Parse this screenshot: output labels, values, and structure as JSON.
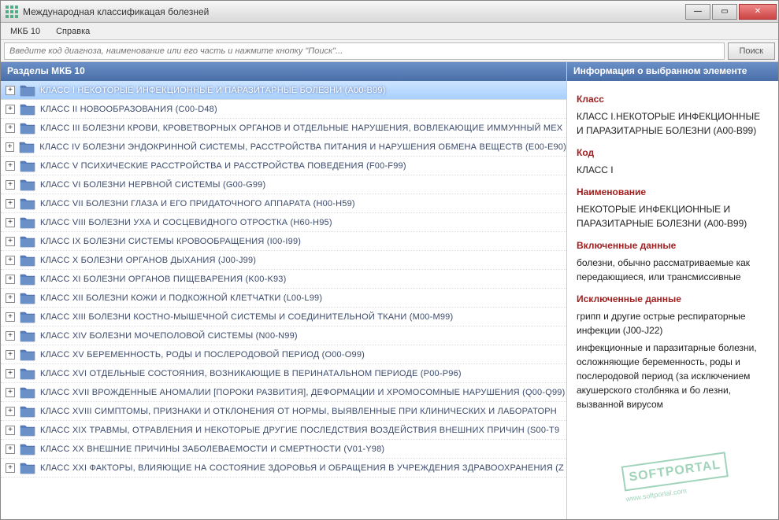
{
  "window": {
    "title": "Международная классификацая болезней"
  },
  "menu": {
    "mkb": "МКБ 10",
    "help": "Справка"
  },
  "search": {
    "placeholder": "Введите код диагноза, наименование или его часть и нажмите кнопку \"Поиск\"...",
    "button": "Поиск"
  },
  "left_header": "Разделы МКБ 10",
  "right_header": "Информация о выбранном элементе",
  "tree": [
    "КЛАСС I НЕКОТОРЫЕ ИНФЕКЦИОННЫЕ И ПАРАЗИТАРНЫЕ БОЛЕЗНИ (A00-B99)",
    "КЛАСС II НОВООБРАЗОВАНИЯ (C00-D48)",
    "КЛАСС III БОЛЕЗНИ КРОВИ, КРОВЕТВОРНЫХ ОРГАНОВ И ОТДЕЛЬНЫЕ НАРУШЕНИЯ, ВОВЛЕКАЮЩИЕ ИММУННЫЙ МЕХ",
    "КЛАСС IV БОЛЕЗНИ ЭНДОКРИННОЙ СИСТЕМЫ, РАССТРОЙСТВА ПИТАНИЯ И НАРУШЕНИЯ ОБМЕНА ВЕЩЕСТВ (E00-E90)",
    "КЛАСС V ПСИХИЧЕСКИЕ РАССТРОЙСТВА И РАССТРОЙСТВА ПОВЕДЕНИЯ (F00-F99)",
    "КЛАСС VI БОЛЕЗНИ НЕРВНОЙ СИСТЕМЫ (G00-G99)",
    "КЛАСС VII БОЛЕЗНИ ГЛАЗА И ЕГО ПРИДАТОЧНОГО АППАРАТА (H00-H59)",
    "КЛАСС VIII БОЛЕЗНИ УХА И СОСЦЕВИДНОГО ОТРОСТКА (H60-H95)",
    "КЛАСС IX БОЛЕЗНИ СИСТЕМЫ КРОВООБРАЩЕНИЯ (I00-I99)",
    "КЛАСС X БОЛЕЗНИ ОРГАНОВ ДЫХАНИЯ (J00-J99)",
    "КЛАСС XI БОЛЕЗНИ ОРГАНОВ ПИЩЕВАРЕНИЯ (K00-K93)",
    "КЛАСС XII БОЛЕЗНИ КОЖИ И ПОДКОЖНОЙ КЛЕТЧАТКИ (L00-L99)",
    "КЛАСС XIII БОЛЕЗНИ КОСТНО-МЫШЕЧНОЙ СИСТЕМЫ И СОЕДИНИТЕЛЬНОЙ ТКАНИ (M00-M99)",
    "КЛАСС XIV БОЛЕЗНИ МОЧЕПОЛОВОЙ СИСТЕМЫ (N00-N99)",
    "КЛАСС XV БЕРЕМЕННОСТЬ, РОДЫ И ПОСЛЕРОДОВОЙ ПЕРИОД (O00-O99)",
    "КЛАСС XVI ОТДЕЛЬНЫЕ СОСТОЯНИЯ, ВОЗНИКАЮЩИЕ В ПЕРИНАТАЛЬНОМ ПЕРИОДЕ (P00-P96)",
    "КЛАСС XVII ВРОЖДЕННЫЕ АНОМАЛИИ [ПОРОКИ РАЗВИТИЯ], ДЕФОРМАЦИИ И ХРОМОСОМНЫЕ НАРУШЕНИЯ (Q00-Q99)",
    "КЛАСС XVIII СИМПТОМЫ, ПРИЗНАКИ И ОТКЛОНЕНИЯ ОТ НОРМЫ, ВЫЯВЛЕННЫЕ ПРИ КЛИНИЧЕСКИХ И ЛАБОРАТОРН",
    "КЛАСС XIX ТРАВМЫ, ОТРАВЛЕНИЯ И НЕКОТОРЫЕ ДРУГИЕ ПОСЛЕДСТВИЯ ВОЗДЕЙСТВИЯ ВНЕШНИХ ПРИЧИН (S00-T9",
    "КЛАСС XX ВНЕШНИЕ ПРИЧИНЫ ЗАБОЛЕВАЕМОСТИ И СМЕРТНОСТИ (V01-Y98)",
    "КЛАСС XXI ФАКТОРЫ, ВЛИЯЮЩИЕ НА СОСТОЯНИЕ ЗДОРОВЬЯ И ОБРАЩЕНИЯ В УЧРЕЖДЕНИЯ ЗДРАВООХРАНЕНИЯ (Z"
  ],
  "selected_index": 0,
  "info": {
    "h_class": "Класс",
    "v_class": "КЛАСС I.НЕКОТОРЫЕ ИНФЕКЦИОННЫЕ И ПАРАЗИТАРНЫЕ БОЛЕЗНИ (A00-B99)",
    "h_code": "Код",
    "v_code": "КЛАСС I",
    "h_name": "Наименование",
    "v_name": "НЕКОТОРЫЕ ИНФЕКЦИОННЫЕ И ПАРАЗИТАРНЫЕ БОЛЕЗНИ (A00-B99)",
    "h_included": "Включенные данные",
    "v_included": "болезни, обычно рассматриваемые как передающиеся, или трансмиссивные",
    "h_excluded": "Исключенные данные",
    "v_excluded1": "грипп и другие острые респираторные инфекции (J00-J22)",
    "v_excluded2": "инфекционные и паразитарные болезни, осложняющие беременность, роды и послеродовой период (за исключением акушерского столбняка и бо лезни, вызванной вирусом"
  },
  "watermark": {
    "main": "SOFTPORTAL",
    "sub": "www.softportal.com"
  }
}
